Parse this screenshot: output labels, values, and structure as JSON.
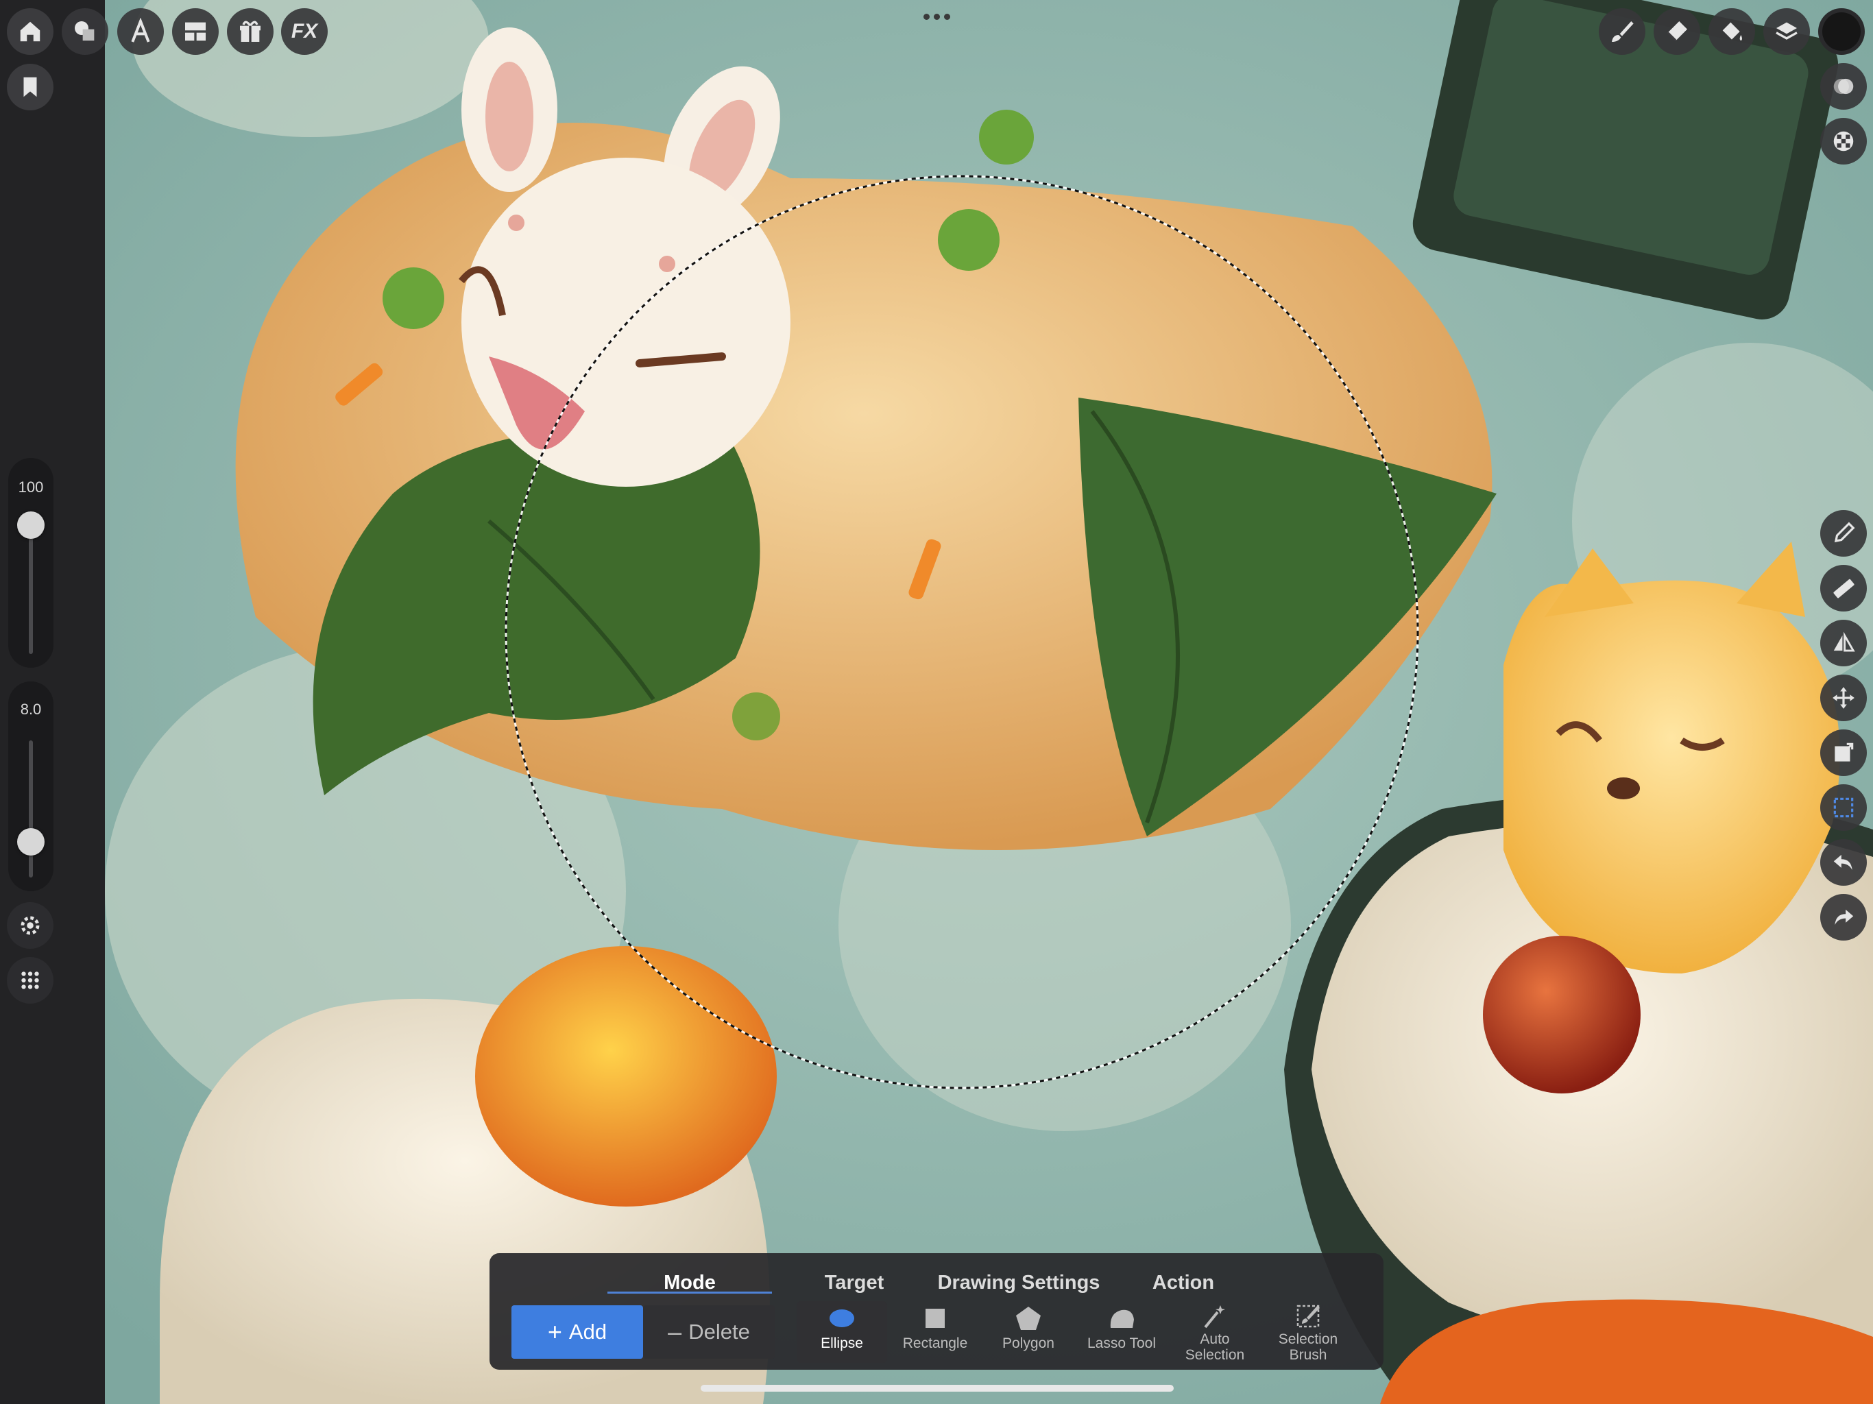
{
  "left_sidebar": {
    "top_buttons": [
      "home-icon",
      "bookmark-icon"
    ],
    "size_slider": {
      "value": "100",
      "level": 1.0
    },
    "opacity_slider": {
      "value": "8.0",
      "level": 0.08
    },
    "bottom_buttons": [
      "gear-icon",
      "grid-icon"
    ]
  },
  "top_toolbar": {
    "left_buttons": [
      "shapes-icon",
      "text-icon",
      "layout-icon",
      "gift-icon"
    ],
    "fx_label": "FX",
    "right_buttons": [
      "brush-icon",
      "eraser-icon",
      "fill-icon",
      "layers-icon",
      "color-swatch"
    ],
    "more_icon": "ellipsis-icon",
    "current_color": "#1a1a1a"
  },
  "right_toolbar": {
    "buttons": [
      "layer-blend-icon",
      "checker-icon",
      "eyedropper-icon",
      "ruler-icon",
      "symmetry-icon",
      "move-icon",
      "transform-icon",
      "selection-icon",
      "undo-icon",
      "redo-icon"
    ]
  },
  "selection_panel": {
    "tabs": [
      "Mode",
      "Target",
      "Drawing Settings",
      "Action"
    ],
    "active_tab": "Mode",
    "add_label": "Add",
    "delete_label": "Delete",
    "tools": [
      {
        "line1": "Ellipse",
        "line2": ""
      },
      {
        "line1": "Rectangle",
        "line2": ""
      },
      {
        "line1": "Polygon",
        "line2": ""
      },
      {
        "line1": "Lasso Tool",
        "line2": ""
      },
      {
        "line1": "Auto",
        "line2": "Selection"
      },
      {
        "line1": "Selection",
        "line2": "Brush"
      }
    ],
    "active_tool": "Ellipse"
  },
  "colors": {
    "accent": "#3e7ee0",
    "canvas_bg": "#8fb3ab",
    "sidebar": "#232325"
  }
}
